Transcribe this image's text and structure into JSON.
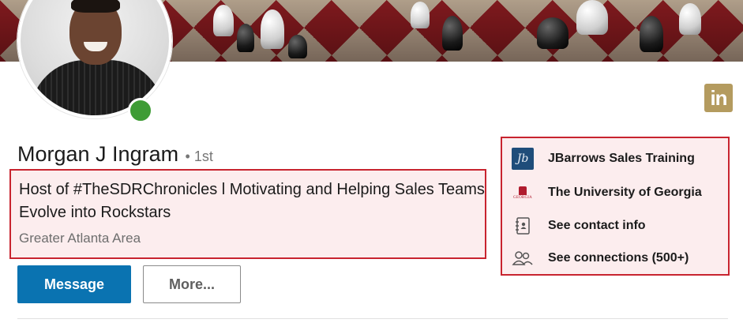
{
  "profile": {
    "name": "Morgan J Ingram",
    "degree": "• 1st",
    "headline": "Host of #TheSDRChronicles l Motivating and Helping Sales Teams Evolve into Rockstars",
    "location": "Greater Atlanta Area",
    "online": true
  },
  "badge": {
    "label": "in",
    "icon": "linkedin-icon"
  },
  "sidebar": {
    "company": {
      "label": "JBarrows Sales Training",
      "logo_text": "Jb"
    },
    "school": {
      "label": "The University of Georgia",
      "logo_text": "GEORGIA"
    },
    "contact": {
      "label": "See contact info",
      "icon": "contact-card-icon"
    },
    "connections": {
      "label": "See connections (500+)",
      "icon": "people-icon"
    }
  },
  "actions": {
    "message_label": "Message",
    "more_label": "More..."
  },
  "colors": {
    "primary": "#0a73b1",
    "highlight_border": "#c8242f",
    "highlight_fill": "#fcedee",
    "online": "#3e9c35",
    "linkedin_badge": "#b49b5f"
  }
}
